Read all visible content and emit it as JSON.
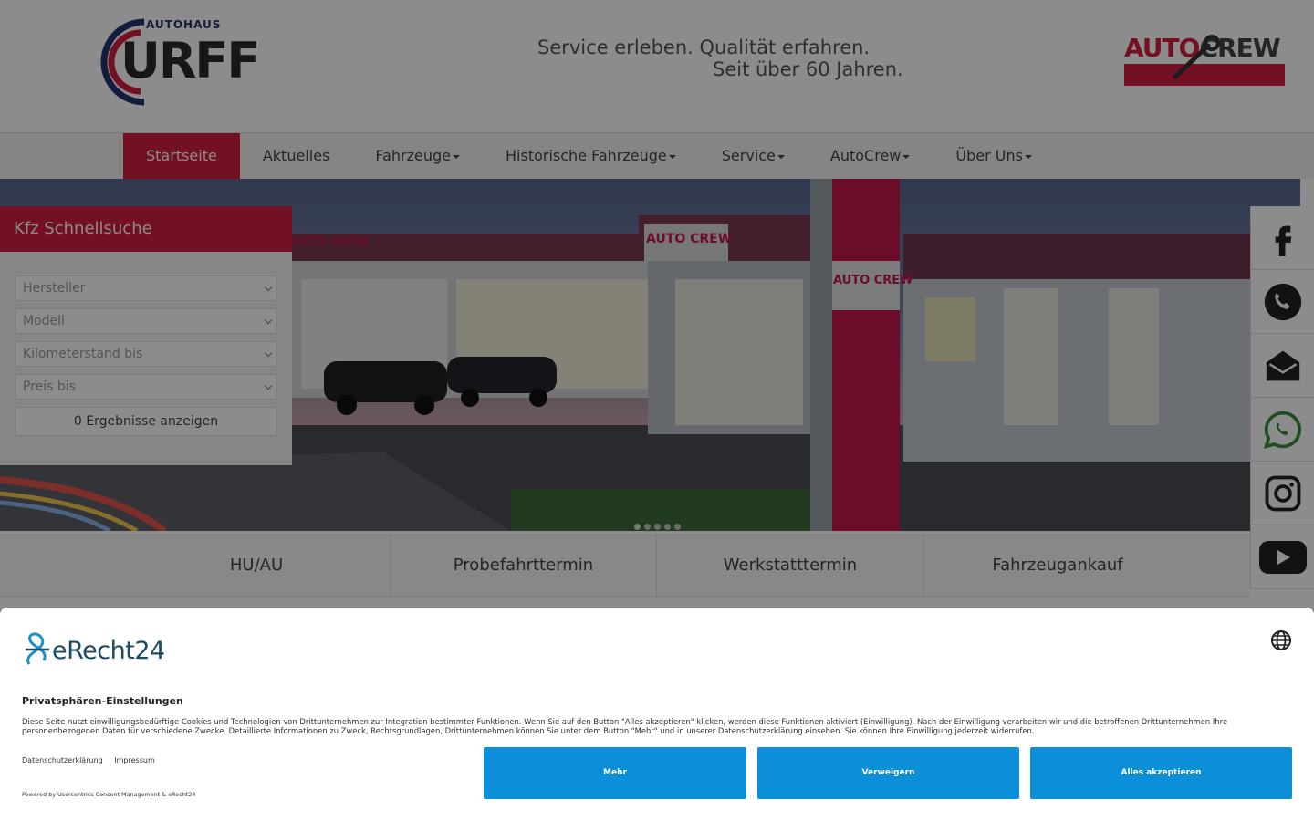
{
  "header": {
    "logo_top": "AUTOHAUS",
    "logo_main": "URFF",
    "slogan_line1": "Service erleben. Qualität erfahren.",
    "slogan_line2": "Seit über 60 Jahren.",
    "partner_logo_part1": "AUTO",
    "partner_logo_part2": "CREW"
  },
  "nav": {
    "items": [
      {
        "label": "Startseite",
        "active": true,
        "dropdown": false
      },
      {
        "label": "Aktuelles",
        "active": false,
        "dropdown": false
      },
      {
        "label": "Fahrzeuge",
        "active": false,
        "dropdown": true
      },
      {
        "label": "Historische Fahrzeuge",
        "active": false,
        "dropdown": true
      },
      {
        "label": "Service",
        "active": false,
        "dropdown": true
      },
      {
        "label": "AutoCrew",
        "active": false,
        "dropdown": true
      },
      {
        "label": "Über Uns",
        "active": false,
        "dropdown": true
      }
    ]
  },
  "hero": {
    "sign1": "AUTO CREW",
    "sign2": "AUTO CREW",
    "sign3": "AUTO CREW"
  },
  "quicksearch": {
    "title": "Kfz Schnellsuche",
    "selects": [
      "Hersteller",
      "Modell",
      "Kilometerstand bis",
      "Preis bis"
    ],
    "button": "0 Ergebnisse anzeigen"
  },
  "social": [
    "facebook-icon",
    "phone-icon",
    "mail-icon",
    "whatsapp-icon",
    "instagram-icon",
    "youtube-icon"
  ],
  "cta": [
    "HU/AU",
    "Probefahrttermin",
    "Werkstatttermin",
    "Fahrzeugankauf"
  ],
  "cookie": {
    "brand": "eRecht24",
    "title": "Privatsphären-Einstellungen",
    "text": "Diese Seite nutzt einwilligungsbedürftige Cookies und Technologien von Drittunternehmen zur Integration bestimmter Funktionen. Wenn Sie auf den Button \"Alles akzeptieren\" klicken, werden diese Funktionen aktiviert (Einwilligung). Nach der Einwilligung verarbeiten wir und die betroffenen Drittunternehmen Ihre personenbezogenen Daten für verschiedene Zwecke. Detaillierte Informationen zu Zweck, Rechtsgrundlagen, Drittunternehmen können Sie unter dem Button \"Mehr\" und in unserer Datenschutzerklärung einsehen. Sie können Ihre Einwilligung jederzeit widerrufen.",
    "link_privacy": "Datenschutzerklärung",
    "link_imprint": "Impressum",
    "powered": "Powered by Usercentrics Consent Management & eRecht24",
    "btn_more": "Mehr",
    "btn_deny": "Verweigern",
    "btn_accept": "Alles akzeptieren"
  },
  "colors": {
    "brand_red": "#d21e3c",
    "brand_navy": "#23346f",
    "cookie_button": "#0a8fd8"
  }
}
